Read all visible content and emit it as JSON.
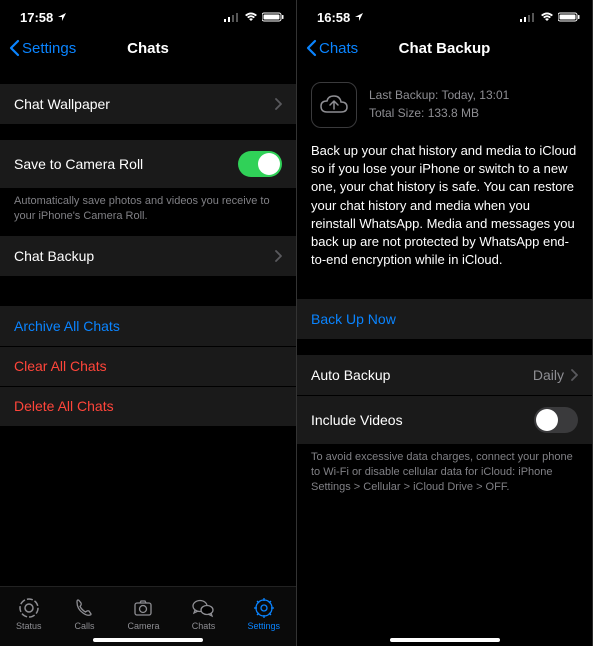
{
  "left": {
    "time": "17:58",
    "nav": {
      "back": "Settings",
      "title": "Chats"
    },
    "wallpaper_label": "Chat Wallpaper",
    "camera_roll_label": "Save to Camera Roll",
    "camera_roll_footer": "Automatically save photos and videos you receive to your iPhone's Camera Roll.",
    "chat_backup_label": "Chat Backup",
    "archive_label": "Archive All Chats",
    "clear_label": "Clear All Chats",
    "delete_label": "Delete All Chats",
    "tabs": {
      "status": "Status",
      "calls": "Calls",
      "camera": "Camera",
      "chats": "Chats",
      "settings": "Settings"
    }
  },
  "right": {
    "time": "16:58",
    "nav": {
      "back": "Chats",
      "title": "Chat Backup"
    },
    "last_backup": "Last Backup: Today, 13:01",
    "total_size": "Total Size: 133.8 MB",
    "description": "Back up your chat history and media to iCloud so if you lose your iPhone or switch to a new one, your chat history is safe. You can restore your chat history and media when you reinstall WhatsApp. Media and messages you back up are not protected by WhatsApp end-to-end encryption while in iCloud.",
    "backup_now_label": "Back Up Now",
    "auto_backup_label": "Auto Backup",
    "auto_backup_value": "Daily",
    "include_videos_label": "Include Videos",
    "footer": "To avoid excessive data charges, connect your phone to Wi-Fi or disable cellular data for iCloud: iPhone Settings > Cellular > iCloud Drive > OFF."
  }
}
